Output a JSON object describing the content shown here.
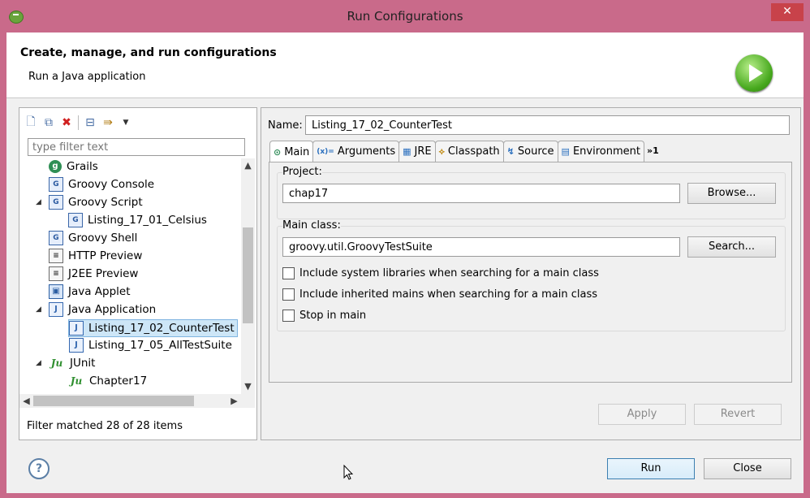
{
  "window": {
    "title": "Run Configurations",
    "close": "✕"
  },
  "header": {
    "title": "Create, manage, and run configurations",
    "subtitle": "Run a Java application"
  },
  "left": {
    "filter_placeholder": "type filter text",
    "filter_status": "Filter matched 28 of 28 items",
    "tree": [
      {
        "label": "Grails",
        "icon": "grails-icon",
        "glyph": "g",
        "twisty": ""
      },
      {
        "label": "Groovy Console",
        "icon": "groovy-console-icon",
        "glyph": "G",
        "twisty": ""
      },
      {
        "label": "Groovy Script",
        "icon": "groovy-script-icon",
        "glyph": "G",
        "twisty": "◢"
      },
      {
        "label": "Listing_17_01_Celsius",
        "icon": "groovy-script-icon",
        "glyph": "G",
        "twisty": ""
      },
      {
        "label": "Groovy Shell",
        "icon": "groovy-shell-icon",
        "glyph": "G",
        "twisty": ""
      },
      {
        "label": "HTTP Preview",
        "icon": "http-preview-icon",
        "glyph": "≡",
        "twisty": ""
      },
      {
        "label": "J2EE Preview",
        "icon": "j2ee-preview-icon",
        "glyph": "≡",
        "twisty": ""
      },
      {
        "label": "Java Applet",
        "icon": "java-applet-icon",
        "glyph": "▣",
        "twisty": ""
      },
      {
        "label": "Java Application",
        "icon": "java-application-icon",
        "glyph": "J",
        "twisty": "◢"
      },
      {
        "label": "Listing_17_02_CounterTest",
        "icon": "java-application-icon",
        "glyph": "J",
        "twisty": ""
      },
      {
        "label": "Listing_17_05_AllTestSuite",
        "icon": "java-application-icon",
        "glyph": "J",
        "twisty": ""
      },
      {
        "label": "JUnit",
        "icon": "junit-icon",
        "glyph": "Ju",
        "twisty": "◢"
      },
      {
        "label": "Chapter17",
        "icon": "junit-icon",
        "glyph": "Ju",
        "twisty": ""
      }
    ]
  },
  "config": {
    "name_label": "Name:",
    "name_value": "Listing_17_02_CounterTest",
    "tabs": [
      {
        "label": "Main",
        "glyph": "⊙"
      },
      {
        "label": "Arguments",
        "glyph": "(x)="
      },
      {
        "label": "JRE",
        "glyph": "▦"
      },
      {
        "label": "Classpath",
        "glyph": "⟡"
      },
      {
        "label": "Source",
        "glyph": "↯"
      },
      {
        "label": "Environment",
        "glyph": "▤"
      },
      {
        "label": "»1",
        "glyph": ""
      }
    ],
    "project_label": "Project:",
    "project_value": "chap17",
    "browse_label": "Browse...",
    "main_class_label": "Main class:",
    "main_class_value": "groovy.util.GroovyTestSuite",
    "search_label": "Search...",
    "checks": [
      {
        "label": "Include system libraries when searching for a main class",
        "checked": false
      },
      {
        "label": "Include inherited mains when searching for a main class",
        "checked": false
      },
      {
        "label": "Stop in main",
        "checked": false
      }
    ],
    "apply_label": "Apply",
    "revert_label": "Revert"
  },
  "footer": {
    "help": "?",
    "run_label": "Run",
    "close_label": "Close"
  }
}
